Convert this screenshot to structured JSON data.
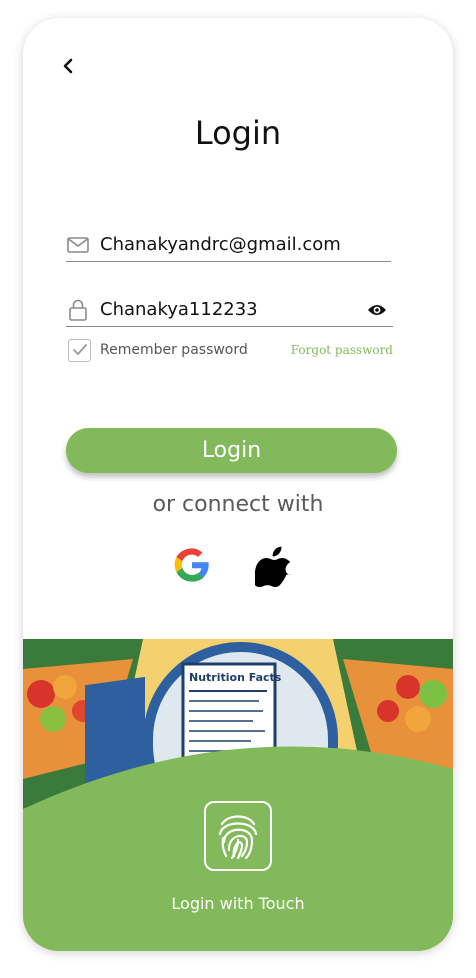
{
  "header": {
    "title": "Login"
  },
  "form": {
    "email_value": "Chanakyandrc@gmail.com",
    "password_value": "Chanakya112233",
    "remember_label": "Remember password",
    "remember_checked": true,
    "forgot_label": "Forgot password",
    "login_label": "Login"
  },
  "social": {
    "divider_text": "or connect with",
    "providers": [
      "google-icon",
      "apple-icon"
    ]
  },
  "hero": {
    "label_title": "Nutrition Facts"
  },
  "touch": {
    "label": "Login with Touch"
  },
  "colors": {
    "accent": "#82b95a",
    "text": "#111111",
    "muted": "#555555"
  }
}
